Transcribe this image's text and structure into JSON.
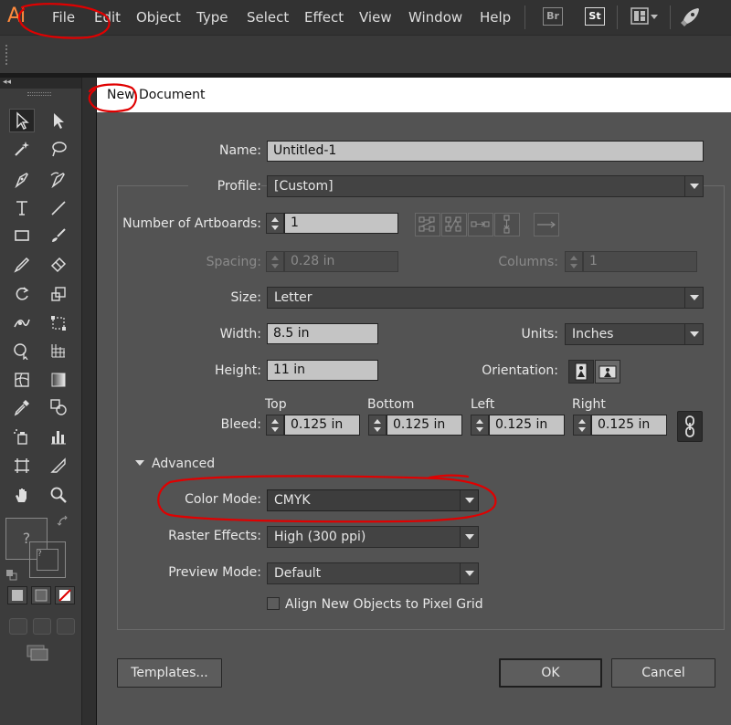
{
  "app": {
    "logo": "Ai"
  },
  "menu": [
    "File",
    "Edit",
    "Object",
    "Type",
    "Select",
    "Effect",
    "View",
    "Window",
    "Help"
  ],
  "menubar_badges": {
    "bridge": "Br",
    "stock": "St"
  },
  "icons": {
    "workspace": "workspace-switcher-icon",
    "publish": "rocket-icon"
  },
  "toolbar": {
    "collapse_label": "◂◂",
    "fill_placeholder": "?",
    "stroke_placeholder": "?"
  },
  "dialog": {
    "title": "New Document",
    "name_label": "Name:",
    "name_value": "Untitled-1",
    "profile_label": "Profile:",
    "profile_value": "[Custom]",
    "artboards_label": "Number of Artboards:",
    "artboards_value": "1",
    "spacing_label": "Spacing:",
    "spacing_value": "0.28 in",
    "columns_label": "Columns:",
    "columns_value": "1",
    "size_label": "Size:",
    "size_value": "Letter",
    "width_label": "Width:",
    "width_value": "8.5 in",
    "units_label": "Units:",
    "units_value": "Inches",
    "height_label": "Height:",
    "height_value": "11 in",
    "orientation_label": "Orientation:",
    "bleed_label": "Bleed:",
    "bleed": {
      "top_label": "Top",
      "top_value": "0.125 in",
      "bottom_label": "Bottom",
      "bottom_value": "0.125 in",
      "left_label": "Left",
      "left_value": "0.125 in",
      "right_label": "Right",
      "right_value": "0.125 in"
    },
    "advanced_label": "Advanced",
    "color_mode_label": "Color Mode:",
    "color_mode_value": "CMYK",
    "raster_label": "Raster Effects:",
    "raster_value": "High (300 ppi)",
    "preview_label": "Preview Mode:",
    "preview_value": "Default",
    "pixel_grid_label": "Align New Objects to Pixel Grid",
    "pixel_grid_checked": false,
    "templates_button": "Templates...",
    "ok_button": "OK",
    "cancel_button": "Cancel"
  },
  "colors": {
    "logo": "#ff8a3d",
    "annotation": "#e00000",
    "dialog_bg": "#535353",
    "menubar_bg": "#323232"
  }
}
